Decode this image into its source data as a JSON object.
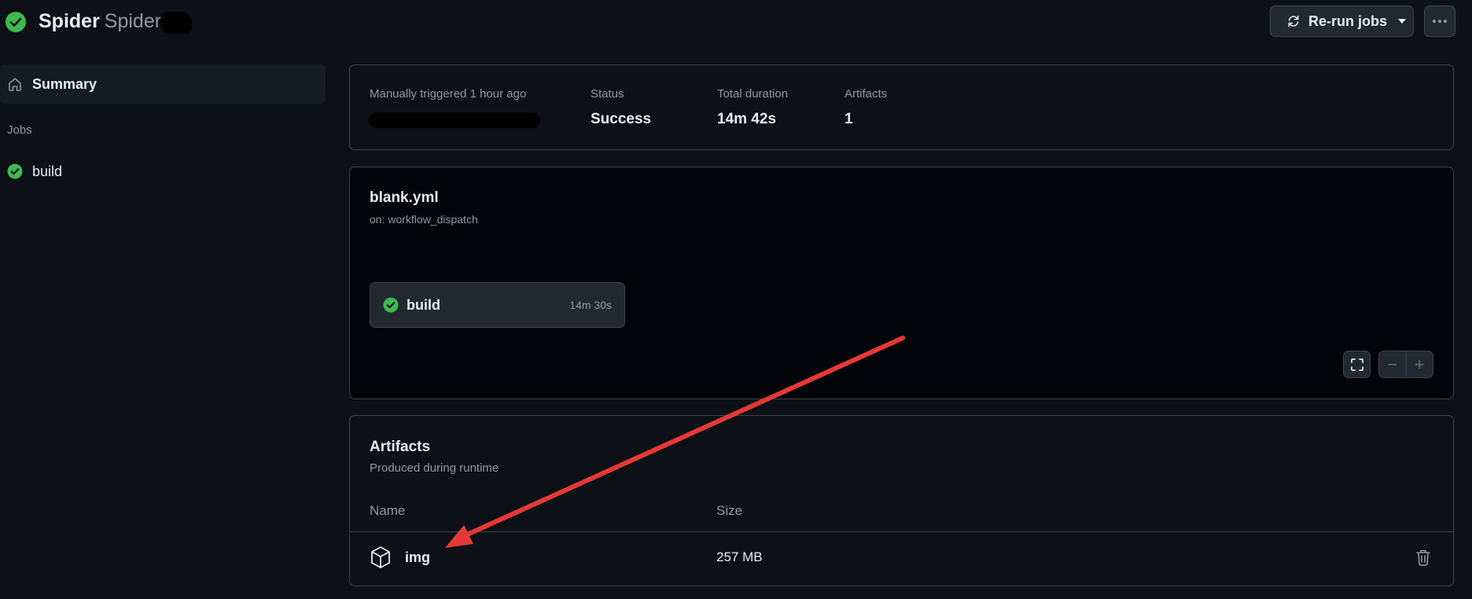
{
  "header": {
    "workflow_name": "Spider",
    "run_name": "Spider",
    "rerun_label": "Re-run jobs"
  },
  "sidebar": {
    "summary_label": "Summary",
    "jobs_heading": "Jobs",
    "jobs": [
      {
        "label": "build"
      }
    ]
  },
  "summary": {
    "trigger_label": "Manually triggered 1 hour ago",
    "status_label": "Status",
    "status_value": "Success",
    "duration_label": "Total duration",
    "duration_value": "14m 42s",
    "artifacts_label": "Artifacts",
    "artifacts_value": "1"
  },
  "workflow": {
    "file": "blank.yml",
    "trigger": "on: workflow_dispatch",
    "job": {
      "name": "build",
      "duration": "14m 30s"
    },
    "zoom_out": "−",
    "zoom_in": "+"
  },
  "artifacts": {
    "title": "Artifacts",
    "subtitle": "Produced during runtime",
    "columns": {
      "name": "Name",
      "size": "Size"
    },
    "rows": [
      {
        "name": "img",
        "size": "257 MB"
      }
    ]
  },
  "colors": {
    "success": "#3fb950",
    "annotation_arrow": "#e53935"
  }
}
